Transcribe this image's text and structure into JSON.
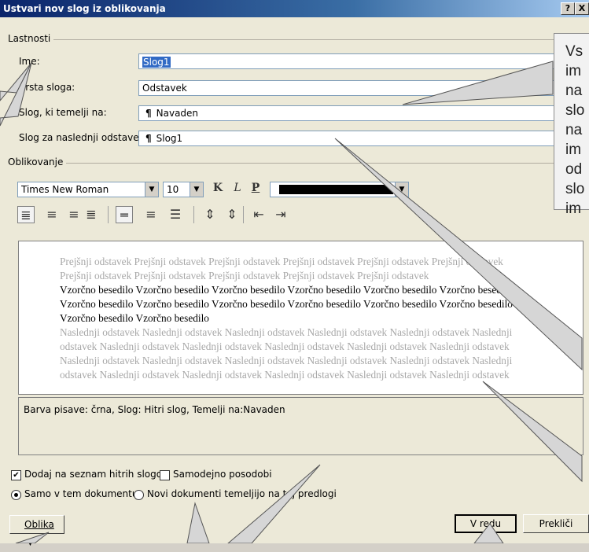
{
  "title": "Ustvari nov slog iz oblikovanja",
  "titlebar_buttons": {
    "help": "?",
    "close": "X"
  },
  "lastnosti": {
    "label": "Lastnosti",
    "ime_label": "Ime:",
    "ime_value": "Slog1",
    "vrsta_label": "Vrsta sloga:",
    "vrsta_value": "Odstavek",
    "temelji_label": "Slog, ki temelji na:",
    "temelji_value": "Navaden",
    "naslednji_label": "Slog za naslednji odstavek:",
    "naslednji_value": "Slog1"
  },
  "oblikovanje": {
    "label": "Oblikovanje",
    "font": "Times New Roman",
    "size": "10",
    "bold": "K",
    "italic": "L",
    "underline": "P",
    "color": "#000000"
  },
  "preview": {
    "prev1": "Prejšnji odstavek Prejšnji odstavek Prejšnji odstavek Prejšnji odstavek Prejšnji odstavek Prejšnji odstavek",
    "prev2": "Prejšnji odstavek Prejšnji odstavek Prejšnji odstavek Prejšnji odstavek Prejšnji odstavek",
    "sample1": "Vzorčno besedilo Vzorčno besedilo Vzorčno besedilo Vzorčno besedilo Vzorčno besedilo Vzorčno besedilo",
    "sample2": "Vzorčno besedilo Vzorčno besedilo Vzorčno besedilo Vzorčno besedilo Vzorčno besedilo Vzorčno besedilo",
    "sample3": "Vzorčno besedilo Vzorčno besedilo",
    "next1": "Naslednji odstavek Naslednji odstavek Naslednji odstavek Naslednji odstavek Naslednji odstavek Naslednji",
    "next2": "odstavek Naslednji odstavek Naslednji odstavek Naslednji odstavek Naslednji odstavek Naslednji odstavek",
    "next3": "Naslednji odstavek Naslednji odstavek Naslednji odstavek Naslednji odstavek Naslednji odstavek Naslednji",
    "next4": "odstavek Naslednji odstavek Naslednji odstavek Naslednji odstavek Naslednji odstavek Naslednji odstavek"
  },
  "description": "Barva pisave: črna, Slog: Hitri slog, Temelji na:Navaden",
  "options": {
    "add_quick": "Dodaj na seznam hitrih slogov",
    "auto_update": "Samodejno posodobi",
    "only_doc": "Samo v tem dokumentu",
    "new_docs": "Novi dokumenti temeljijo na tej predlogi"
  },
  "buttons": {
    "format": "Oblika",
    "ok": "V redu",
    "cancel": "Prekliči"
  },
  "callout": {
    "lines": [
      "Vs",
      "im",
      "na",
      "slo",
      "na",
      "im",
      "od",
      "slo",
      "im"
    ]
  }
}
